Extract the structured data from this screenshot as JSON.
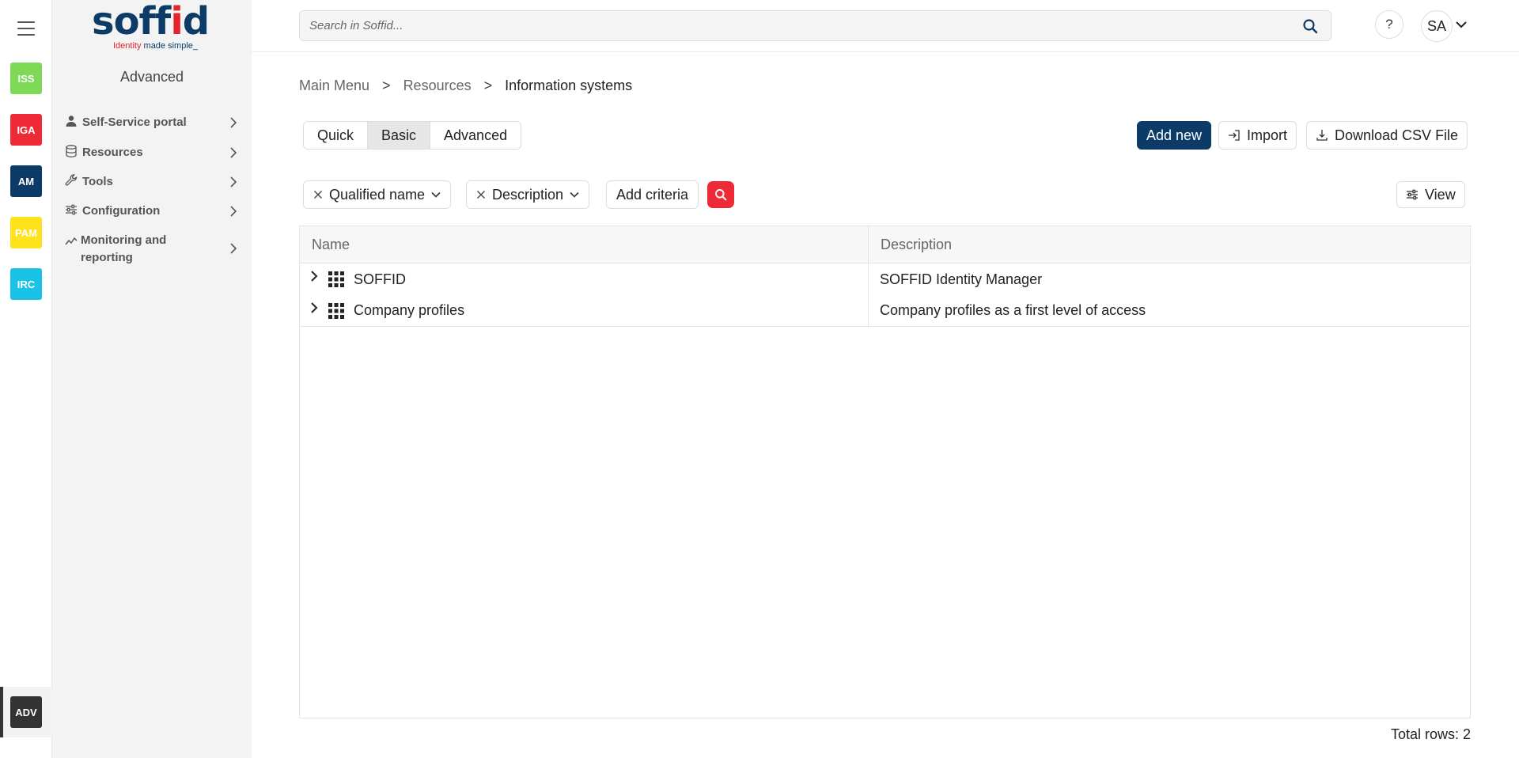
{
  "rail": {
    "apps": [
      {
        "label": "ISS",
        "color": "#7ed957"
      },
      {
        "label": "IGA",
        "color": "#ee2a37"
      },
      {
        "label": "AM",
        "color": "#0b3b66"
      },
      {
        "label": "PAM",
        "color": "#ffe11c"
      },
      {
        "label": "IRC",
        "color": "#19c3e6"
      }
    ],
    "active_app": {
      "label": "ADV",
      "color": "#333333"
    }
  },
  "logo": {
    "word_part1": "soff",
    "word_part2": "i",
    "word_part3": "d",
    "tag_red": "Identity",
    "tag_rest": " made simple_"
  },
  "sidebar": {
    "title": "Advanced",
    "items": [
      {
        "label": "Self-Service portal",
        "icon": "person-icon"
      },
      {
        "label": "Resources",
        "icon": "database-icon"
      },
      {
        "label": "Tools",
        "icon": "wrench-icon"
      },
      {
        "label": "Configuration",
        "icon": "sliders-icon"
      },
      {
        "label": "Monitoring and reporting",
        "icon": "chart-line-icon"
      }
    ]
  },
  "topbar": {
    "search_placeholder": "Search in Soffid...",
    "help_label": "?",
    "user_initials": "SA"
  },
  "breadcrumb": {
    "items": [
      "Main Menu",
      "Resources",
      "Information systems"
    ],
    "separator": ">"
  },
  "mode_tabs": {
    "tabs": [
      "Quick",
      "Basic",
      "Advanced"
    ],
    "active": "Basic"
  },
  "actions": {
    "add_new": "Add new",
    "import": "Import",
    "download_csv": "Download CSV File"
  },
  "filters": {
    "chips": [
      "Qualified name",
      "Description"
    ],
    "add_criteria": "Add criteria",
    "view": "View"
  },
  "table": {
    "columns": [
      "Name",
      "Description"
    ],
    "rows": [
      {
        "name": "SOFFID",
        "description": "SOFFID Identity Manager"
      },
      {
        "name": "Company profiles",
        "description": "Company profiles as a first level of access"
      }
    ],
    "total_rows_label": "Total rows: 2"
  },
  "colors": {
    "primary": "#0b3b66",
    "accent_red": "#ee2a37"
  }
}
